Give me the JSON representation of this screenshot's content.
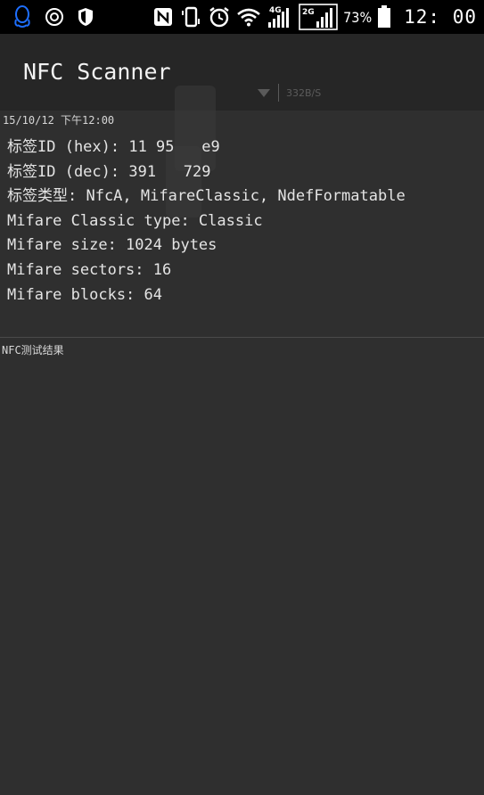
{
  "status_bar": {
    "icons_left": [
      "qq-icon",
      "settings-circle-icon",
      "shield-icon"
    ],
    "icons_right": [
      "nfc-icon",
      "vibrate-icon",
      "alarm-icon",
      "wifi-icon",
      "signal-4g-icon",
      "signal-2g-icon",
      "battery-icon"
    ],
    "network_1": "4G",
    "network_2": "2G",
    "battery_percent": "73%",
    "time": "12: 00",
    "accent_color": "#1e6fff"
  },
  "action_bar": {
    "title": "NFC Scanner",
    "overlay_text": "332B/S"
  },
  "scan": {
    "timestamp": "15/10/12 下午12:00",
    "lines": [
      "标签ID (hex): 11 95   e9",
      "标签ID (dec): 391   729",
      "标签类型: NfcA, MifareClassic, NdefFormatable",
      "Mifare Classic type: Classic",
      "Mifare size: 1024 bytes",
      "Mifare sectors: 16",
      "Mifare blocks: 64"
    ]
  },
  "result_label": "NFC测试结果"
}
